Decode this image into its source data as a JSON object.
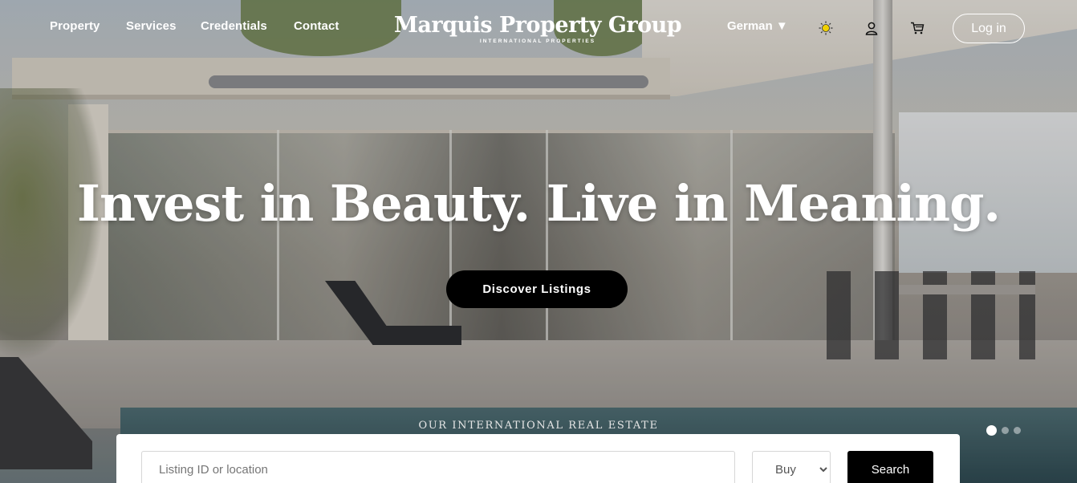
{
  "nav": {
    "links": [
      {
        "label": "Property"
      },
      {
        "label": "Services"
      },
      {
        "label": "Credentials"
      },
      {
        "label": "Contact"
      }
    ],
    "language": "German ▼",
    "login_label": "Log in",
    "icons": [
      "sun-icon",
      "user-icon",
      "cart-icon"
    ]
  },
  "brand": {
    "name": "Marquis Property Group",
    "tagline": "INTERNATIONAL PROPERTIES"
  },
  "hero": {
    "headline": "Invest in Beauty. Live in Meaning.",
    "cta_label": "Discover Listings",
    "section_label": "OUR INTERNATIONAL REAL ESTATE",
    "slides": 3,
    "active_slide": 1
  },
  "search": {
    "placeholder": "Listing ID or location",
    "type_options": [
      "Buy"
    ],
    "selected_type": "Buy",
    "button_label": "Search"
  },
  "colors": {
    "text_on_hero": "#ffffff",
    "button_bg": "#000000",
    "sun_icon": "#f0d000"
  }
}
